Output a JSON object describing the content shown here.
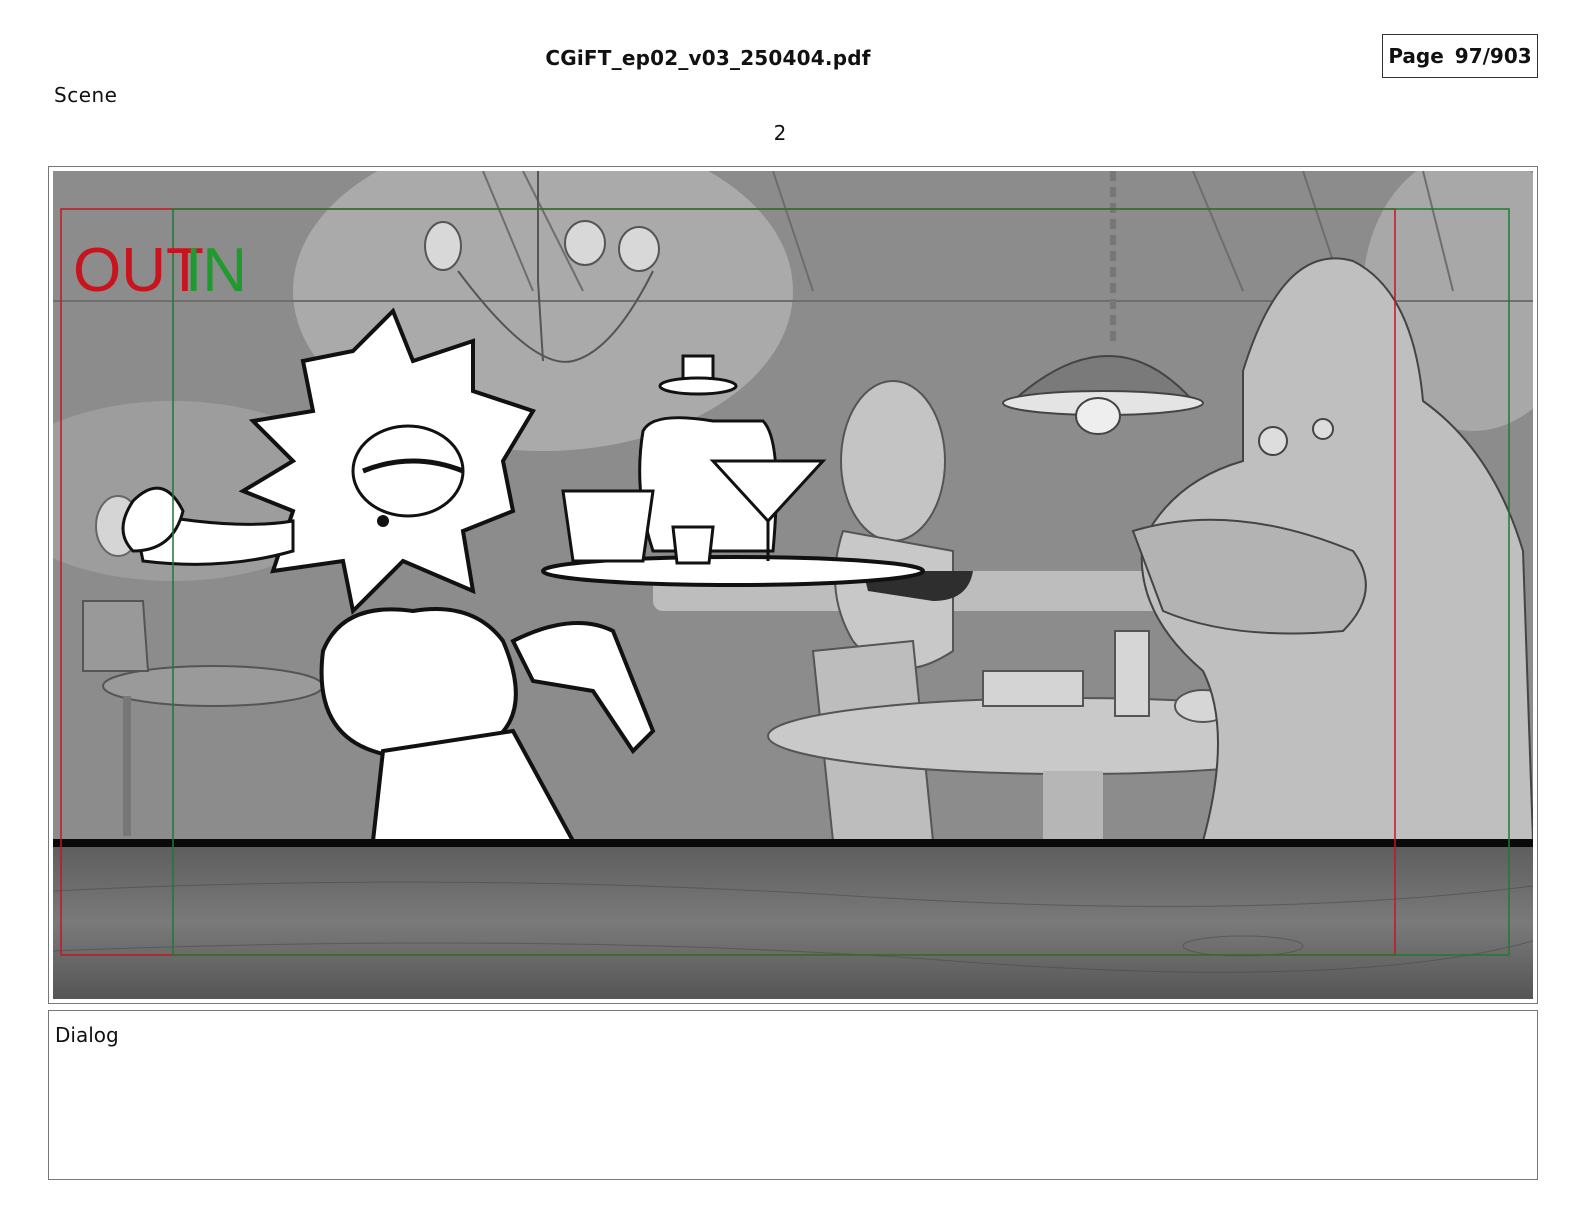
{
  "header": {
    "document_title": "CGiFT_ep02_v03_250404.pdf",
    "page_label": "Page",
    "page_number": "97/903"
  },
  "scene": {
    "label": "Scene",
    "number": "2"
  },
  "panel": {
    "out_marker": "OUT",
    "in_marker": "IN",
    "out_color": "#c8141e",
    "in_color": "#1f9a2e"
  },
  "dialog": {
    "label": "Dialog",
    "text": ""
  }
}
